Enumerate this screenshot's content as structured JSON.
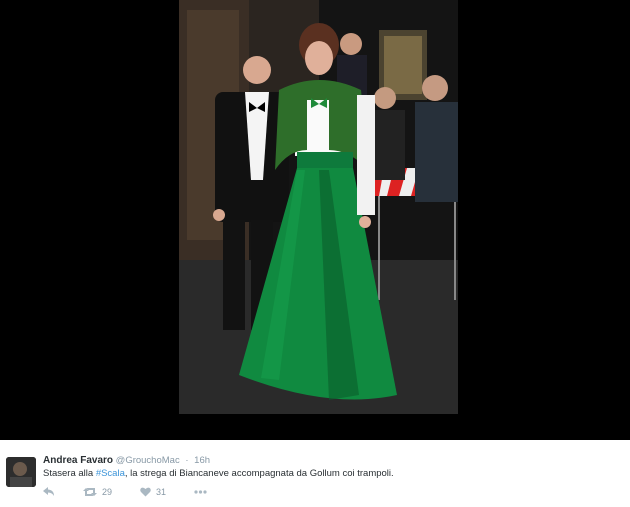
{
  "tweet": {
    "name": "Andrea Favaro",
    "handle": "@GrouchoMac",
    "separator": "·",
    "time": "16h",
    "text_before": "Stasera alla ",
    "hashtag": "#Scala",
    "text_after": ", la strega di Biancaneve accompagnata da Gollum coi trampoli.",
    "retweet_count": "29",
    "like_count": "31"
  },
  "icons": {
    "reply": "reply-icon",
    "retweet": "retweet-icon",
    "like": "heart-icon",
    "more": "more-icon"
  },
  "colors": {
    "hashtag": "#3b94d9",
    "name": "#292f33",
    "meta": "#8899a6",
    "icon": "#aab8c2"
  }
}
